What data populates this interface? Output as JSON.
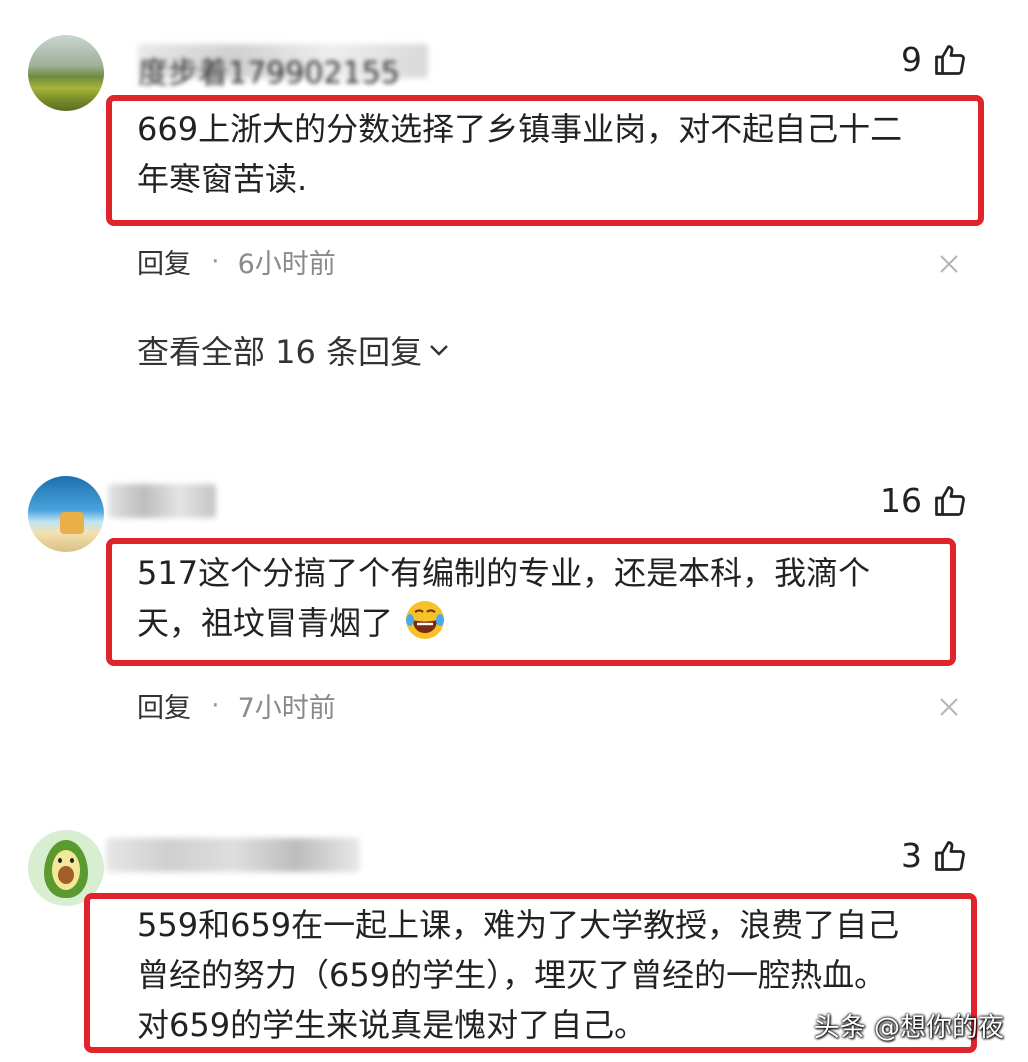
{
  "comments": [
    {
      "username": "度步着179902155",
      "likes": "9",
      "text_line1": "669上浙大的分数选择了乡镇事业岗，对不起自己十二",
      "text_line2": "年寒窗苦读.",
      "reply_label": "回复",
      "separator": "·",
      "time": "6小时前",
      "view_all_replies": "查看全部 16 条回复"
    },
    {
      "username": "",
      "likes": "16",
      "text_line1": "517这个分搞了个有编制的专业，还是本科，我滴个",
      "text_line2": "天，祖坟冒青烟了",
      "emoji": "laughing-crying-emoji",
      "reply_label": "回复",
      "separator": "·",
      "time": "7小时前"
    },
    {
      "username": "",
      "likes": "3",
      "text_line1": "559和659在一起上课，难为了大学教授，浪费了自己",
      "text_line2": "曾经的努力（659的学生），埋灭了曾经的一腔热血。",
      "text_line3": "对659的学生来说真是愧对了自己。"
    }
  ],
  "watermark": "头条 @想你的夜",
  "colors": {
    "highlight_border": "#e0242b",
    "text": "#222222",
    "meta_time": "#8a8a8a"
  },
  "icons": [
    "thumb-up-icon",
    "close-icon",
    "chevron-down-icon"
  ]
}
